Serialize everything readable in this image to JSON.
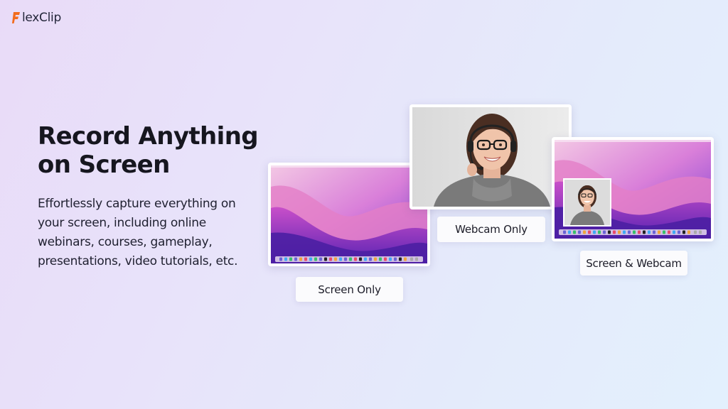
{
  "brand": {
    "logo_text_accent": "F",
    "logo_text_rest": "lexClip",
    "accent_color": "#f26b1d"
  },
  "hero": {
    "headline_line1": "Record Anything",
    "headline_line2": "on Screen",
    "description": "Effortlessly capture everything on your screen, including online webinars, courses, gameplay, presentations, video tutorials, etc."
  },
  "modes": [
    {
      "label": "Screen Only",
      "preview": "macos-desktop"
    },
    {
      "label": "Webcam Only",
      "preview": "webcam-person"
    },
    {
      "label": "Screen & Webcam",
      "preview": "desktop-with-webcam-overlay"
    }
  ]
}
